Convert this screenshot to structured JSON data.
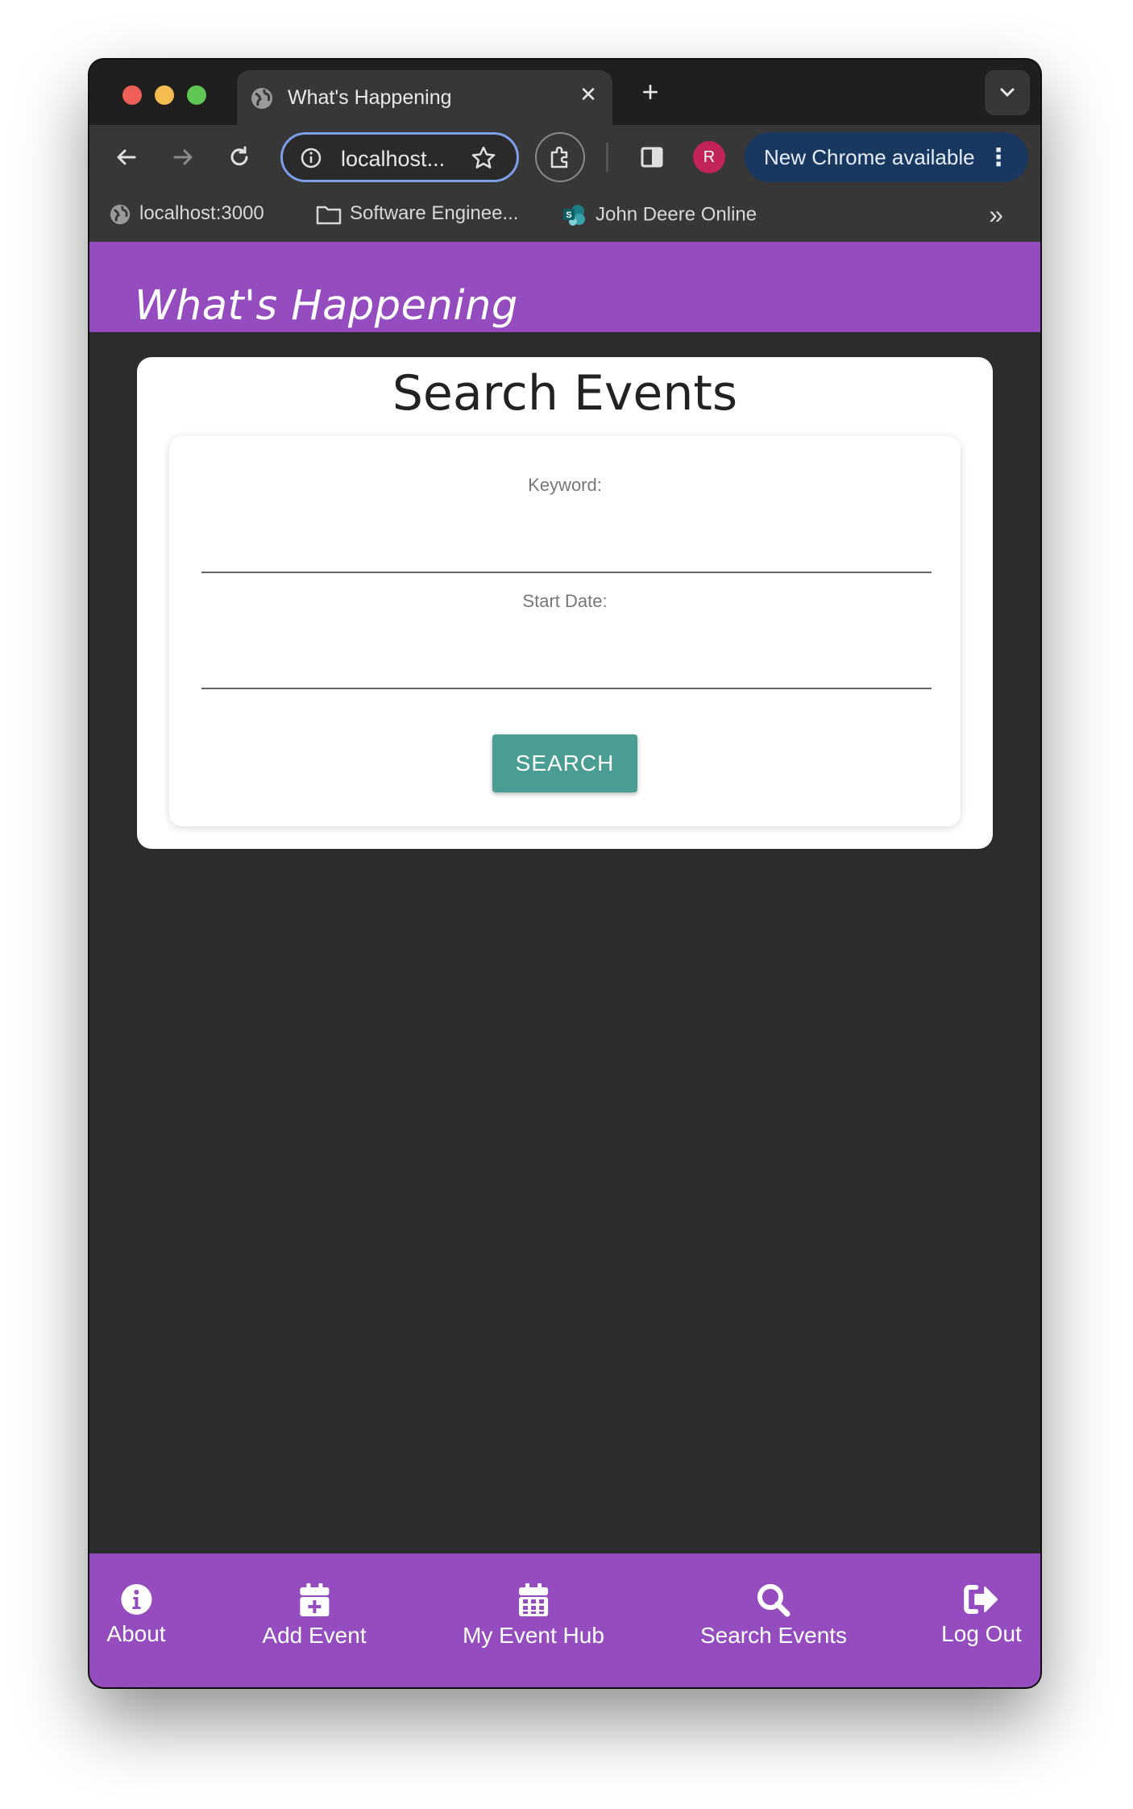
{
  "browser": {
    "tab_title": "What's Happening",
    "tab_close": "✕",
    "new_tab": "+",
    "address": "localhost...",
    "avatar_initial": "R",
    "update_label": "New Chrome available",
    "update_menu": "⋮",
    "bookmarks": [
      {
        "label": "localhost:3000",
        "icon": "globe-icon"
      },
      {
        "label": "Software Enginee...",
        "icon": "folder-icon"
      },
      {
        "label": "John Deere Online",
        "icon": "sharepoint-icon"
      }
    ],
    "bookmarks_more": "»"
  },
  "app": {
    "title": "What's Happening",
    "header_color": "#944cbf"
  },
  "search_card": {
    "heading": "Search Events",
    "keyword_label": "Keyword:",
    "keyword_value": "",
    "start_date_label": "Start Date:",
    "start_date_value": "",
    "search_button": "SEARCH",
    "button_color": "#4a9d93"
  },
  "bottom_nav": [
    {
      "label": "About",
      "icon": "info-icon"
    },
    {
      "label": "Add Event",
      "icon": "calendar-plus-icon"
    },
    {
      "label": "My Event Hub",
      "icon": "calendar-icon"
    },
    {
      "label": "Search Events",
      "icon": "search-icon"
    },
    {
      "label": "Log Out",
      "icon": "sign-out-icon"
    }
  ]
}
